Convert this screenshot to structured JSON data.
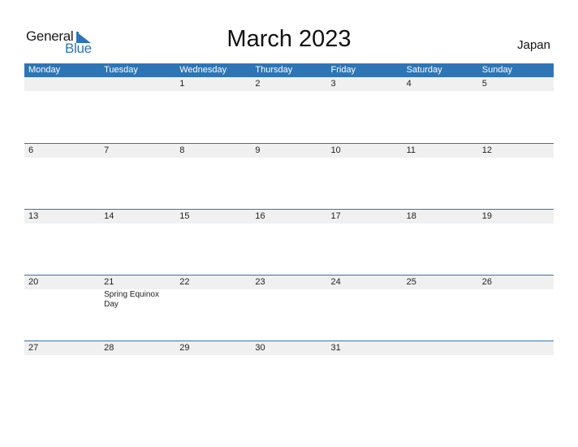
{
  "logo": {
    "word1": "General",
    "word2": "Blue"
  },
  "header": {
    "title": "March 2023",
    "country": "Japan"
  },
  "colors": {
    "accent": "#2e75b6",
    "strip": "#f0f0f0"
  },
  "weekdays": [
    "Monday",
    "Tuesday",
    "Wednesday",
    "Thursday",
    "Friday",
    "Saturday",
    "Sunday"
  ],
  "weeks": [
    {
      "days": [
        "",
        "",
        "1",
        "2",
        "3",
        "4",
        "5"
      ],
      "events": [
        "",
        "",
        "",
        "",
        "",
        "",
        ""
      ]
    },
    {
      "days": [
        "6",
        "7",
        "8",
        "9",
        "10",
        "11",
        "12"
      ],
      "events": [
        "",
        "",
        "",
        "",
        "",
        "",
        ""
      ]
    },
    {
      "days": [
        "13",
        "14",
        "15",
        "16",
        "17",
        "18",
        "19"
      ],
      "events": [
        "",
        "",
        "",
        "",
        "",
        "",
        ""
      ]
    },
    {
      "days": [
        "20",
        "21",
        "22",
        "23",
        "24",
        "25",
        "26"
      ],
      "events": [
        "",
        "Spring Equinox Day",
        "",
        "",
        "",
        "",
        ""
      ]
    },
    {
      "days": [
        "27",
        "28",
        "29",
        "30",
        "31",
        "",
        ""
      ],
      "events": [
        "",
        "",
        "",
        "",
        "",
        "",
        ""
      ]
    }
  ]
}
